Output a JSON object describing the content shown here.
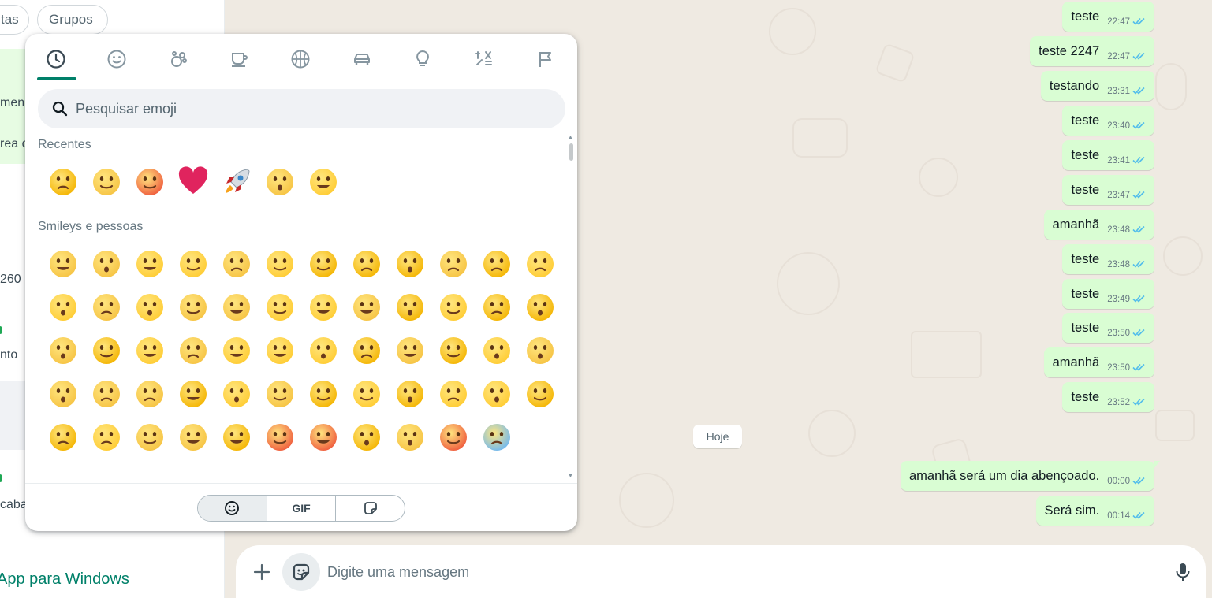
{
  "sidebar": {
    "filters": [
      "tas",
      "Grupos"
    ],
    "fragments": [
      "men",
      "rea c",
      "260",
      "nto",
      "caba"
    ],
    "download_link": "App para Windows"
  },
  "chat": {
    "date_divider": "Hoje",
    "messages": [
      {
        "text": "teste",
        "time": "22:47"
      },
      {
        "text": "teste 2247",
        "time": "22:47"
      },
      {
        "text": "testando",
        "time": "23:31"
      },
      {
        "text": "teste",
        "time": "23:40"
      },
      {
        "text": "teste",
        "time": "23:41"
      },
      {
        "text": "teste",
        "time": "23:47"
      },
      {
        "text": "amanhã",
        "time": "23:48"
      },
      {
        "text": "teste",
        "time": "23:48"
      },
      {
        "text": "teste",
        "time": "23:49"
      },
      {
        "text": "teste",
        "time": "23:50"
      },
      {
        "text": "amanhã",
        "time": "23:50"
      },
      {
        "text": "teste",
        "time": "23:52"
      },
      {
        "text": "amanhã será um dia abençoado.",
        "time": "00:00"
      },
      {
        "text": "Será sim.",
        "time": "00:14"
      }
    ],
    "read_tick_color": "#53bdeb"
  },
  "composer": {
    "placeholder": "Digite uma mensagem",
    "icons": [
      "plus-icon",
      "sticker-icon",
      "mic-icon"
    ]
  },
  "emoji_panel": {
    "categories": [
      "recent-icon",
      "smiley-icon",
      "animal-icon",
      "food-icon",
      "activity-icon",
      "travel-icon",
      "objects-icon",
      "symbols-icon",
      "flags-icon"
    ],
    "active_category": "recent-icon",
    "search_placeholder": "Pesquisar emoji",
    "recent_title": "Recentes",
    "smileys_title": "Smileys e pessoas",
    "recent_emojis": [
      "😂",
      "😉",
      "🥵",
      "❤️",
      "🚀",
      "😳",
      "🥰"
    ],
    "smiley_emojis": [
      "😀",
      "😃",
      "😄",
      "😁",
      "😆",
      "🥹",
      "😅",
      "😂",
      "🤣",
      "🥲",
      "☺️",
      "😊",
      "😇",
      "🙂",
      "🙃",
      "😉",
      "😌",
      "😍",
      "🥰",
      "😘",
      "😗",
      "😙",
      "😚",
      "😋",
      "😛",
      "😝",
      "😜",
      "🤪",
      "🤨",
      "🧐",
      "🤓",
      "😎",
      "🥸",
      "🤩",
      "🥳",
      "😏",
      "😏",
      "😒",
      "😞",
      "😔",
      "😟",
      "😕",
      "🙁",
      "☹️",
      "😣",
      "😖",
      "😫",
      "😩",
      "🥺",
      "😢",
      "😭",
      "😤",
      "😠",
      "😡",
      "🤬",
      "🤯",
      "😳",
      "🥵",
      "🥶"
    ],
    "tabs": [
      "emoji-tab-icon",
      "GIF",
      "sticker-tab-icon"
    ],
    "active_tab": "emoji-tab-icon",
    "accent": "#008069"
  }
}
